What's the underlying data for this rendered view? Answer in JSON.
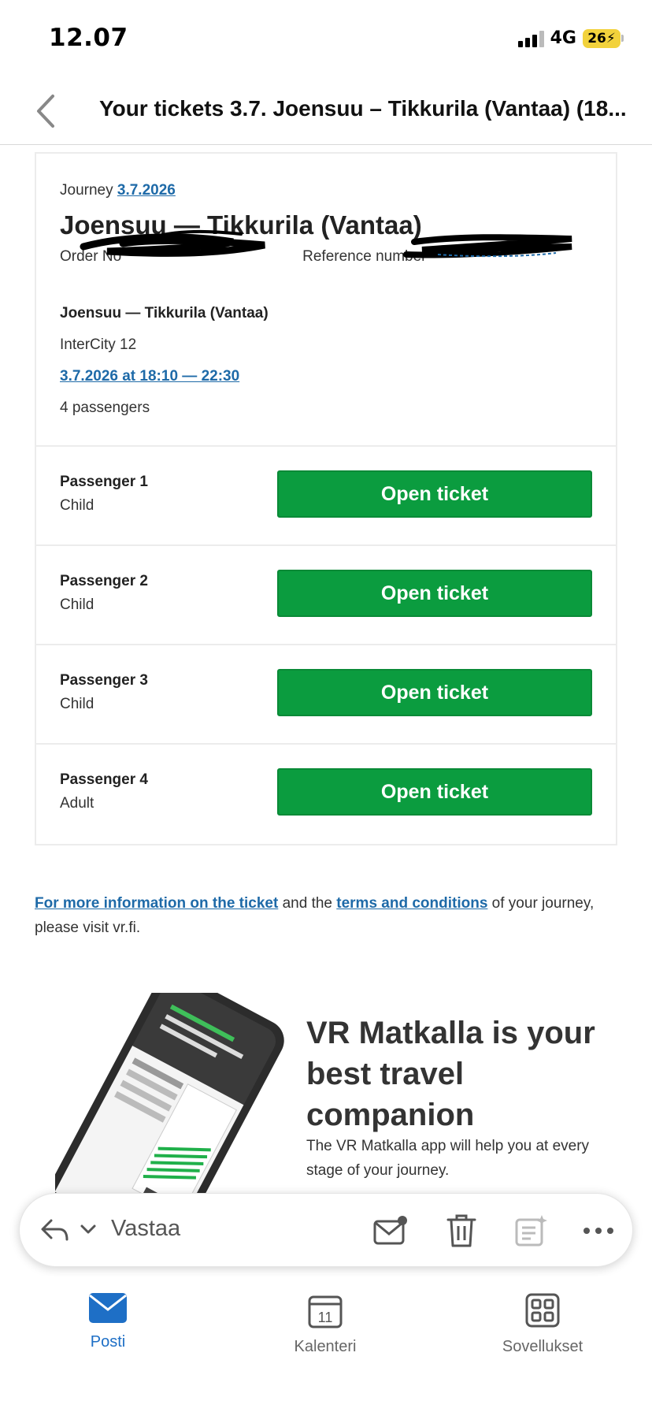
{
  "status_bar": {
    "time": "12.07",
    "network": "4G",
    "battery": "26"
  },
  "header": {
    "title": "Your tickets 3.7. Joensuu – Tikkurila (Vantaa) (18..."
  },
  "journey": {
    "label": "Journey",
    "date_link": "3.7.2026",
    "route": "Joensuu — Tikkurila (Vantaa)",
    "order_label": "Order No",
    "reference_label": "Reference number",
    "sub_route": "Joensuu — Tikkurila (Vantaa)",
    "train": "InterCity 12",
    "time_link": "3.7.2026 at 18:10 — 22:30",
    "passengers": "4 passengers"
  },
  "passenger_list": [
    {
      "name": "Passenger 1",
      "type": "Child",
      "button": "Open ticket"
    },
    {
      "name": "Passenger 2",
      "type": "Child",
      "button": "Open ticket"
    },
    {
      "name": "Passenger 3",
      "type": "Child",
      "button": "Open ticket"
    },
    {
      "name": "Passenger 4",
      "type": "Adult",
      "button": "Open ticket"
    }
  ],
  "info": {
    "link1": "For more information on the ticket",
    "mid": " and the ",
    "link2": "terms and conditions",
    "end": " of your journey, please visit vr.fi."
  },
  "promo": {
    "title": "VR Matkalla is your best travel companion",
    "text": "The VR Matkalla app will help you at every stage of your journey."
  },
  "reply_bar": {
    "reply_label": "Vastaa"
  },
  "tabs": [
    {
      "label": "Posti",
      "active": true
    },
    {
      "label": "Kalenteri",
      "day": "11"
    },
    {
      "label": "Sovellukset"
    }
  ],
  "colors": {
    "accent": "#1e6fc6",
    "button_green": "#0b9c3f",
    "link": "#1e6aa8"
  }
}
